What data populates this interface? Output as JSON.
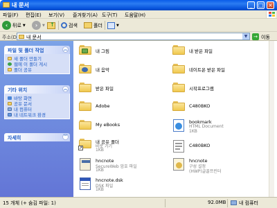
{
  "window": {
    "title": "내 문서"
  },
  "menu": [
    "파일(F)",
    "편집(E)",
    "보기(V)",
    "즐겨찾기(A)",
    "도구(T)",
    "도움말(H)"
  ],
  "toolbar": {
    "back": "뒤로",
    "search": "검색",
    "folders": "폴더"
  },
  "address": {
    "label": "주소(D)",
    "value": "내 문서",
    "go": "이동"
  },
  "tasks": {
    "title": "파일 및 폴더 작업",
    "items": [
      "새 폴더 만들기",
      "웹에 이 폴더 게시",
      "폴더 공유"
    ]
  },
  "places": {
    "title": "기타 위치",
    "items": [
      "바탕 화면",
      "공유 문서",
      "내 컴퓨터",
      "내 네트워크 환경"
    ]
  },
  "details": {
    "title": "자세히"
  },
  "files": [
    {
      "name": "내 그림",
      "overlay": "picture"
    },
    {
      "name": "내 받은 파일",
      "overlay": "none"
    },
    {
      "name": "내 음악",
      "overlay": "music"
    },
    {
      "name": "네이트온 받은 파일",
      "overlay": "none"
    },
    {
      "name": "받은 파일",
      "overlay": "none"
    },
    {
      "name": "시작프로그램",
      "overlay": "none"
    },
    {
      "name": "Adobe",
      "overlay": "none"
    },
    {
      "name": "C480BKO",
      "overlay": "none"
    },
    {
      "name": "My eBooks",
      "overlay": "none"
    },
    {
      "name": "bookmark",
      "sub1": "HTML Document",
      "sub2": "1KB",
      "icon": "html"
    },
    {
      "name": "내 공유 폴더",
      "sub1": "바로 가기",
      "sub2": "1KB",
      "icon": "shortcut"
    },
    {
      "name": "C480BKO",
      "icon": "doc"
    },
    {
      "name": "hncnote",
      "sub1": "SecureWeb 암호 파일",
      "sub2": "1KB",
      "icon": "secure"
    },
    {
      "name": "hncnote",
      "sub1": "구성 설정",
      "sub2": "(HWP)글꼴프린터",
      "icon": "config"
    },
    {
      "name": "hncnote.dsk",
      "sub1": "DSK 파일",
      "sub2": "1KB",
      "icon": "dsk"
    }
  ],
  "status": {
    "objects": "15 개체 (+ 숨김 파일: 1)",
    "size": "92.0MB",
    "location": "내 컴퓨터"
  }
}
